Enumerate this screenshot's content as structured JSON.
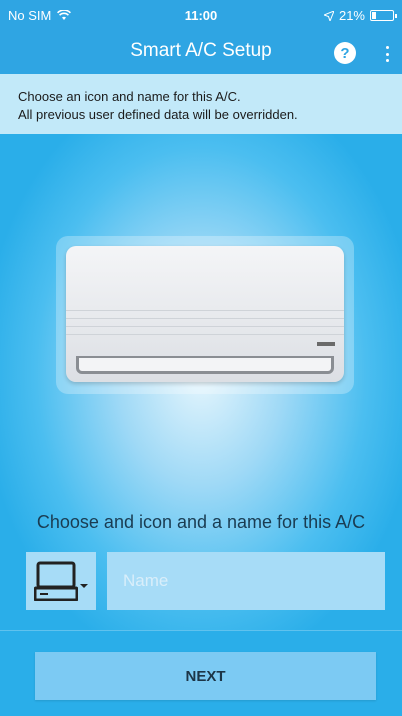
{
  "statusbar": {
    "carrier": "No SIM",
    "time": "11:00",
    "battery": "21%",
    "battery_level": 0.21
  },
  "appbar": {
    "title": "Smart A/C Setup",
    "help_label": "?"
  },
  "notice": {
    "line1": "Choose an icon and name for this A/C.",
    "line2": "All previous user defined data will be overridden."
  },
  "main": {
    "illustration": "air-conditioner",
    "prompt": "Choose and icon and a name for this A/C"
  },
  "form": {
    "selected_icon": "computer-icon",
    "name_value": "",
    "name_placeholder": "Name"
  },
  "footer": {
    "next_label": "NEXT"
  },
  "colors": {
    "primary": "#2fa5e3",
    "notice_bg": "#c2e9f9",
    "field_bg": "#a7dcf7",
    "button_bg": "#7ccaf3"
  }
}
